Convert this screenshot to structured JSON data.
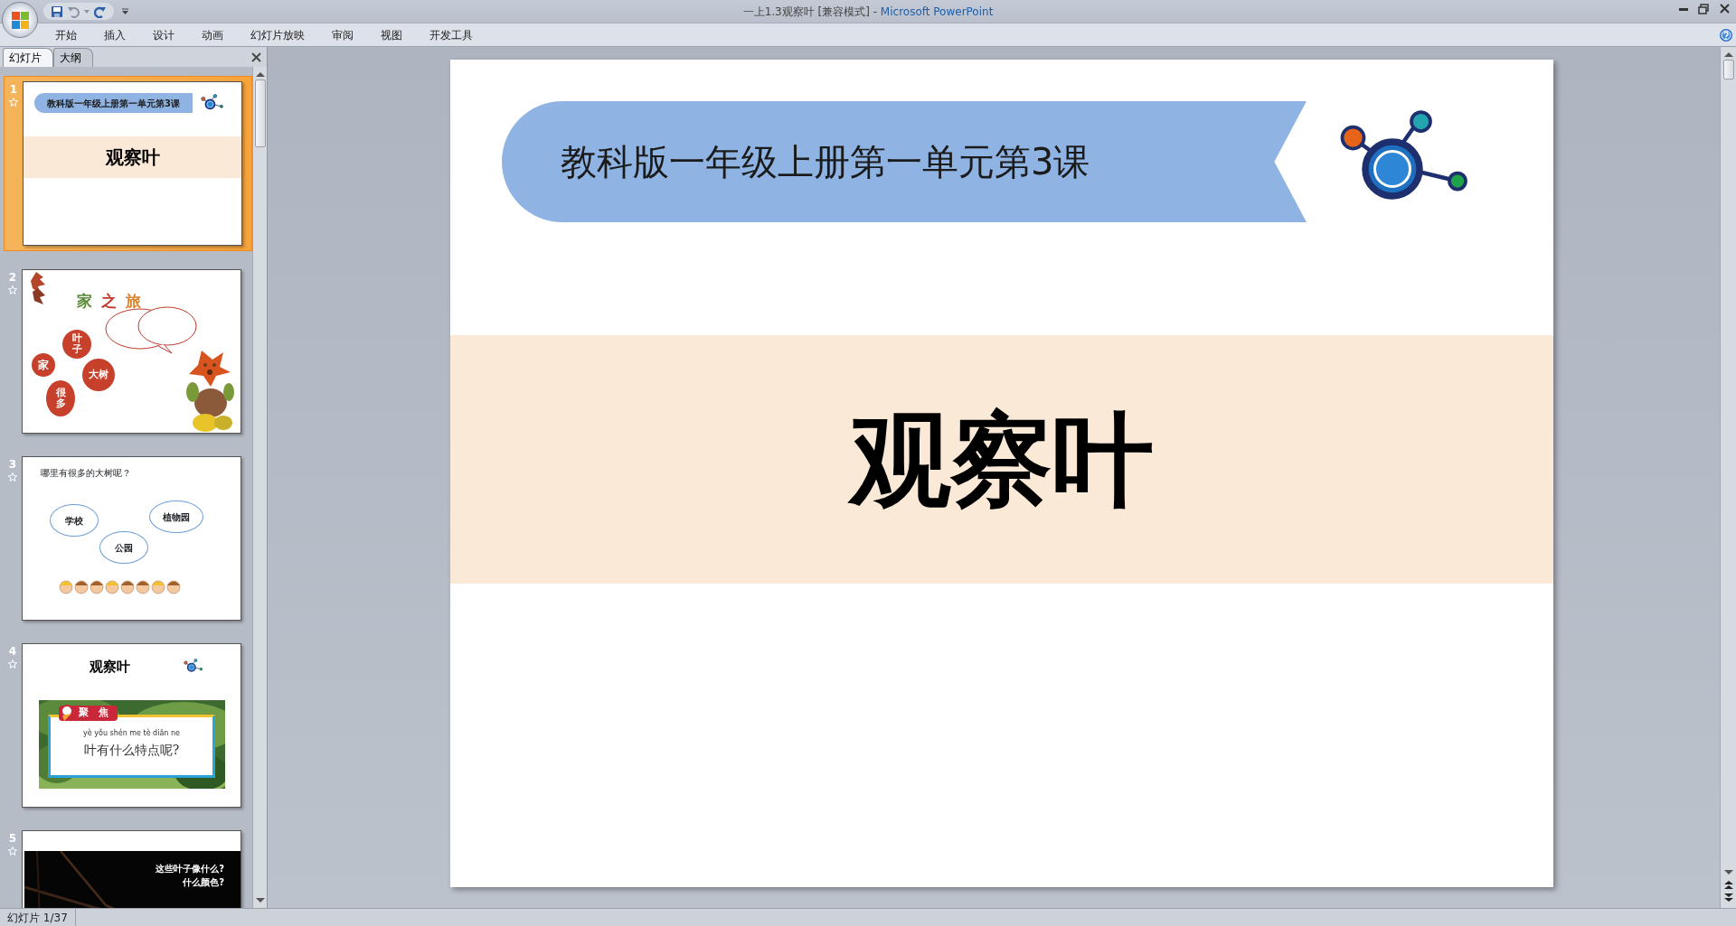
{
  "window": {
    "title": "一上1.3观察叶 [兼容模式]",
    "separator": "-",
    "app": "Microsoft PowerPoint"
  },
  "ribbon_tabs": [
    "开始",
    "插入",
    "设计",
    "动画",
    "幻灯片放映",
    "审阅",
    "视图",
    "开发工具"
  ],
  "panel_tabs": [
    {
      "label": "幻灯片",
      "selected": true
    },
    {
      "label": "大纲",
      "selected": false
    }
  ],
  "slides": [
    {
      "number": "1",
      "selected": true,
      "kind": "title",
      "header": "教科版一年级上册第一单元第3课",
      "title": "观察叶"
    },
    {
      "number": "2",
      "selected": false,
      "kind": "journey",
      "title_parts": [
        {
          "text": "家",
          "color": "#5a8a3a"
        },
        {
          "text": "之",
          "color": "#c0392b"
        },
        {
          "text": "旅",
          "color": "#d9822b"
        }
      ],
      "circles": [
        "叶子",
        "家",
        "大树",
        "很多"
      ]
    },
    {
      "number": "3",
      "selected": false,
      "kind": "clouds",
      "question": "哪里有很多的大树呢？",
      "clouds": [
        "学校",
        "植物园",
        "公园"
      ]
    },
    {
      "number": "4",
      "selected": false,
      "kind": "focus",
      "title": "观察叶",
      "tag": "聚　焦",
      "pinyin": "yè yǒu shén me tè diǎn ne",
      "question": "叶有什么特点呢?"
    },
    {
      "number": "5",
      "selected": false,
      "lines": [
        "这些叶子**像什么**?",
        "**什么颜色**?"
      ]
    }
  ],
  "main_slide": {
    "header": "教科版一年级上册第一单元第3课",
    "title": "观察叶"
  },
  "status_bar": {
    "slide_count": "幻灯片 1/37"
  }
}
